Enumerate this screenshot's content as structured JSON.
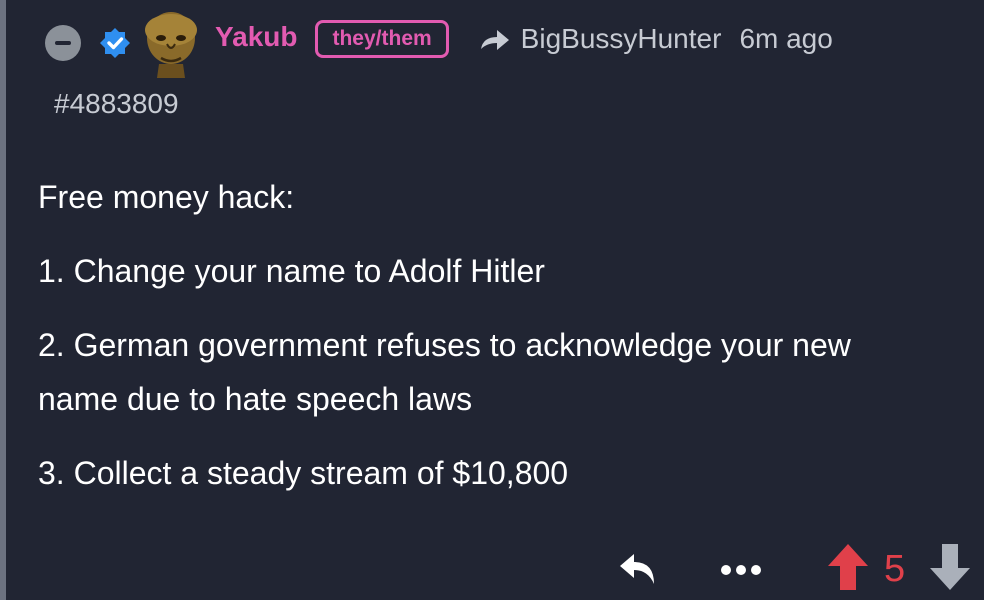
{
  "comment": {
    "author": "Yakub",
    "pronouns": "they/them",
    "reply_to": "BigBussyHunter",
    "timestamp": "6m ago",
    "comment_id": "#4883809",
    "body": [
      "Free money hack:",
      "1. Change your name to Adolf Hitler",
      "2. German government refuses to acknowledge your new name due to hate speech laws",
      "3. Collect a steady stream of $10,800"
    ],
    "score": "5"
  },
  "colors": {
    "background": "#212533",
    "username": "#e25bb1",
    "upvote": "#e0404a",
    "verified": "#2f8ff0"
  },
  "icons": {
    "collapse": "minus-circle-icon",
    "verified": "verified-badge-icon",
    "reply_to": "share-arrow-icon",
    "reply": "reply-arrow-icon",
    "more": "ellipsis-icon",
    "upvote": "arrow-up-icon",
    "downvote": "arrow-down-icon"
  }
}
